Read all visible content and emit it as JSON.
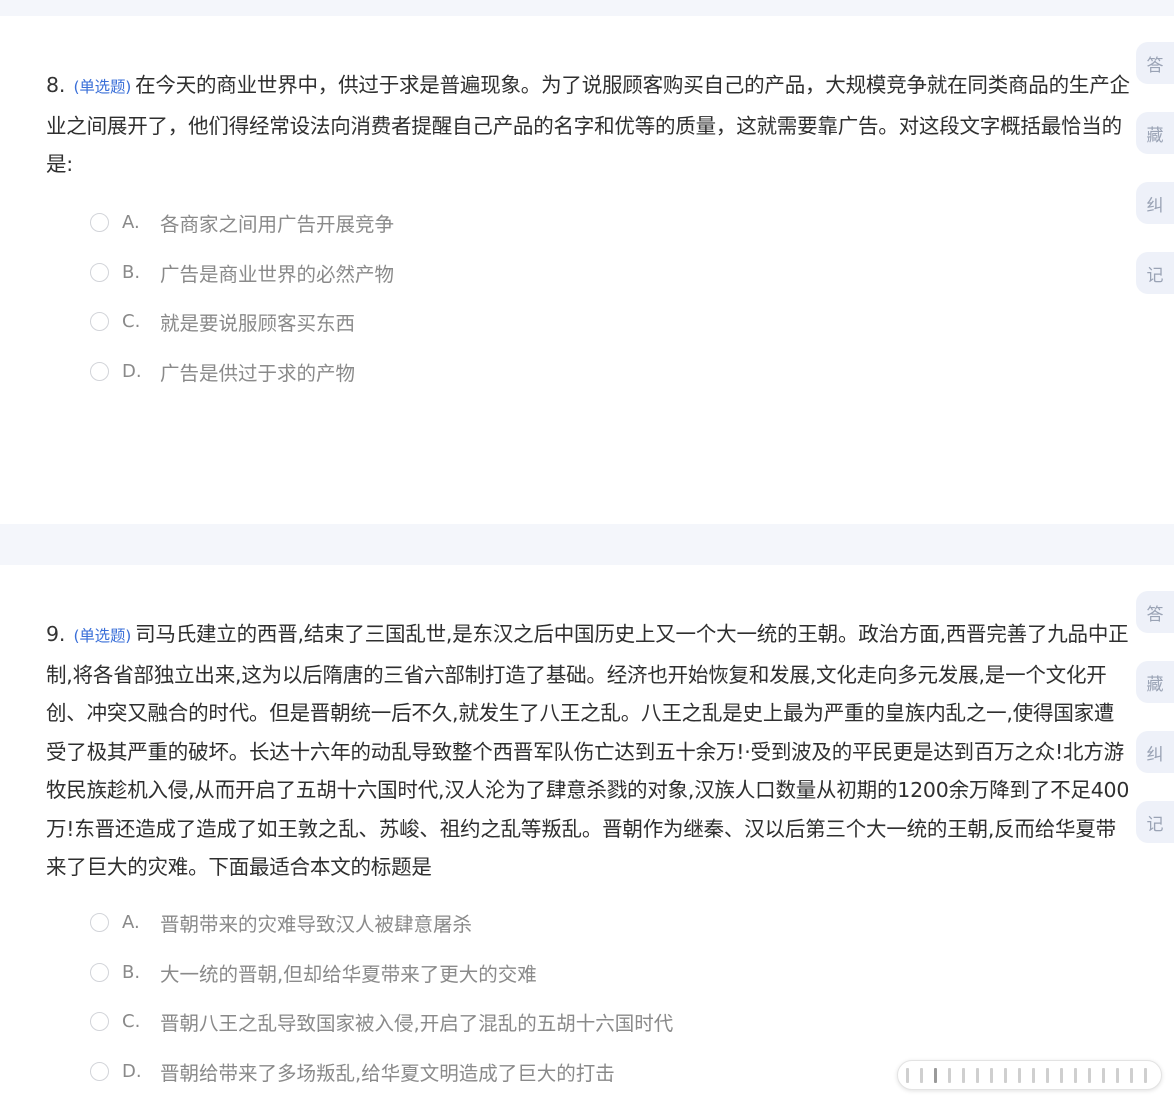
{
  "questions": [
    {
      "number": "8.",
      "type": "(单选题)",
      "stem": "在今天的商业世界中，供过于求是普遍现象。为了说服顾客购买自己的产品，大规模竞争就在同类商品的生产企业之间展开了，他们得经常设法向消费者提醒自己产品的名字和优等的质量，这就需要靠广告。对这段文字概括最恰当的是:",
      "options": [
        {
          "letter": "A.",
          "text": "各商家之间用广告开展竞争"
        },
        {
          "letter": "B.",
          "text": "广告是商业世界的必然产物"
        },
        {
          "letter": "C.",
          "text": "就是要说服顾客买东西"
        },
        {
          "letter": "D.",
          "text": "广告是供过于求的产物"
        }
      ]
    },
    {
      "number": "9.",
      "type": "(单选题)",
      "stem": "司马氏建立的西晋,结束了三国乱世,是东汉之后中国历史上又一个大一统的王朝。政治方面,西晋完善了九品中正制,将各省部独立出来,这为以后隋唐的三省六部制打造了基础。经济也开始恢复和发展,文化走向多元发展,是一个文化开创、冲突又融合的时代。但是晋朝统一后不久,就发生了八王之乱。八王之乱是史上最为严重的皇族内乱之一,使得国家遭受了极其严重的破坏。长达十六年的动乱导致整个西晋军队伤亡达到五十余万!·受到波及的平民更是达到百万之众!北方游牧民族趁机入侵,从而开启了五胡十六国时代,汉人沦为了肆意杀戮的对象,汉族人口数量从初期的1200余万降到了不足400万!东晋还造成了造成了如王敦之乱、苏峻、祖约之乱等叛乱。晋朝作为继秦、汉以后第三个大一统的王朝,反而给华夏带来了巨大的灾难。下面最适合本文的标题是",
      "options": [
        {
          "letter": "A.",
          "text": "晋朝带来的灾难导致汉人被肆意屠杀"
        },
        {
          "letter": "B.",
          "text": "大一统的晋朝,但却给华夏带来了更大的交难"
        },
        {
          "letter": "C.",
          "text": "晋朝八王之乱导致国家被入侵,开启了混乱的五胡十六国时代"
        },
        {
          "letter": "D.",
          "text": "晋朝给带来了多场叛乱,给华夏文明造成了巨大的打击"
        }
      ]
    }
  ],
  "side_actions": {
    "answer": "答",
    "favorite": "藏",
    "correct": "纠",
    "note": "记"
  },
  "colors": {
    "accent": "#3a6fd8",
    "background": "#f4f6fb",
    "side_button": "#eef1f9"
  }
}
